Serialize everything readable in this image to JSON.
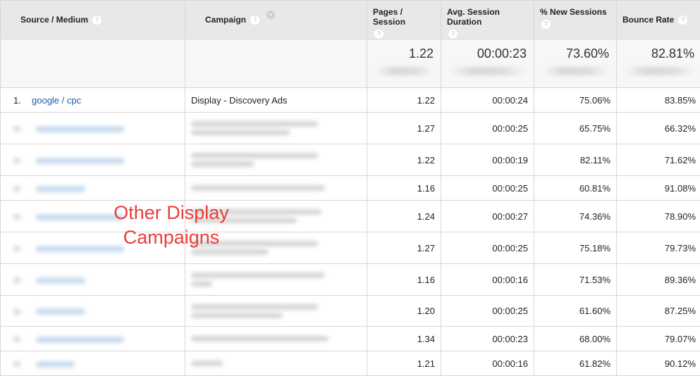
{
  "columns": {
    "source_medium": "Source / Medium",
    "campaign": "Campaign",
    "pages_session": "Pages / Session",
    "avg_session_duration": "Avg. Session Duration",
    "new_sessions": "% New Sessions",
    "bounce_rate": "Bounce Rate"
  },
  "icons": {
    "help": "?",
    "remove": "×"
  },
  "totals": {
    "pages_session": "1.22",
    "avg_session_duration": "00:00:23",
    "new_sessions": "73.60%",
    "bounce_rate": "82.81%"
  },
  "rows": [
    {
      "index": "1.",
      "source": "google / cpc",
      "campaign": "Display - Discovery Ads",
      "pages": "1.22",
      "duration": "00:00:24",
      "new": "75.06%",
      "bounce": "83.85%"
    },
    {
      "index": "",
      "source": "",
      "campaign": "",
      "pages": "1.27",
      "duration": "00:00:25",
      "new": "65.75%",
      "bounce": "66.32%"
    },
    {
      "index": "",
      "source": "",
      "campaign": "",
      "pages": "1.22",
      "duration": "00:00:19",
      "new": "82.11%",
      "bounce": "71.62%"
    },
    {
      "index": "",
      "source": "",
      "campaign": "",
      "pages": "1.16",
      "duration": "00:00:25",
      "new": "60.81%",
      "bounce": "91.08%"
    },
    {
      "index": "",
      "source": "",
      "campaign": "",
      "pages": "1.24",
      "duration": "00:00:27",
      "new": "74.36%",
      "bounce": "78.90%"
    },
    {
      "index": "",
      "source": "",
      "campaign": "",
      "pages": "1.27",
      "duration": "00:00:25",
      "new": "75.18%",
      "bounce": "79.73%"
    },
    {
      "index": "",
      "source": "",
      "campaign": "",
      "pages": "1.16",
      "duration": "00:00:16",
      "new": "71.53%",
      "bounce": "89.36%"
    },
    {
      "index": "",
      "source": "",
      "campaign": "",
      "pages": "1.20",
      "duration": "00:00:25",
      "new": "61.60%",
      "bounce": "87.25%"
    },
    {
      "index": "",
      "source": "",
      "campaign": "",
      "pages": "1.34",
      "duration": "00:00:23",
      "new": "68.00%",
      "bounce": "79.07%"
    },
    {
      "index": "",
      "source": "",
      "campaign": "",
      "pages": "1.21",
      "duration": "00:00:16",
      "new": "61.82%",
      "bounce": "90.12%"
    }
  ],
  "annotation": {
    "line1": "Other Display",
    "line2": "Campaigns",
    "color": "#ef3b3b"
  },
  "colors": {
    "link": "#1a5ea6",
    "header_bg": "#e8e8e8",
    "totals_bg": "#f7f7f7"
  }
}
